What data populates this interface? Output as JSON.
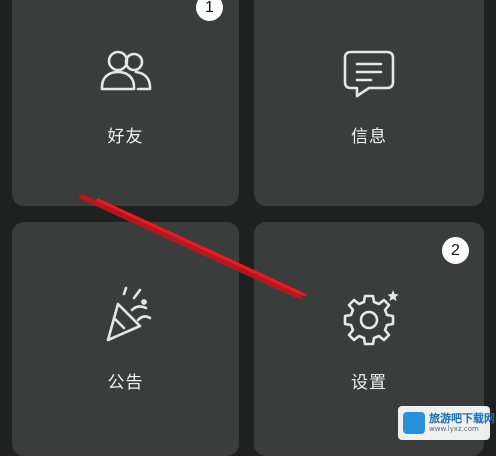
{
  "tiles": [
    {
      "label": "好友",
      "icon": "friends-icon"
    },
    {
      "label": "信息",
      "icon": "message-icon"
    },
    {
      "label": "公告",
      "icon": "announcement-icon"
    },
    {
      "label": "设置",
      "icon": "settings-icon"
    }
  ],
  "badges": {
    "step1": "1",
    "step2": "2"
  },
  "watermark": {
    "title": "旅游吧下载网",
    "url": "www.lyxz.com"
  },
  "colors": {
    "background": "#1f2020",
    "tile": "#3b3d3d",
    "icon_stroke": "#e6e6e6",
    "annotation_arrow": "#c8121a"
  }
}
